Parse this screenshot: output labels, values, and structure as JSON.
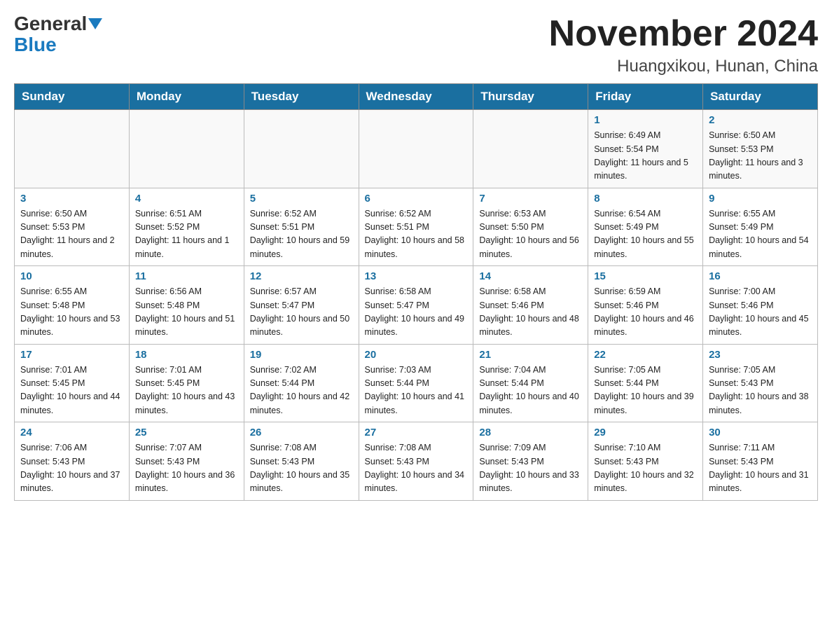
{
  "header": {
    "logo_general": "General",
    "logo_blue": "Blue",
    "month_title": "November 2024",
    "location": "Huangxikou, Hunan, China"
  },
  "days_of_week": [
    "Sunday",
    "Monday",
    "Tuesday",
    "Wednesday",
    "Thursday",
    "Friday",
    "Saturday"
  ],
  "weeks": [
    [
      {
        "day": "",
        "info": ""
      },
      {
        "day": "",
        "info": ""
      },
      {
        "day": "",
        "info": ""
      },
      {
        "day": "",
        "info": ""
      },
      {
        "day": "",
        "info": ""
      },
      {
        "day": "1",
        "info": "Sunrise: 6:49 AM\nSunset: 5:54 PM\nDaylight: 11 hours and 5 minutes."
      },
      {
        "day": "2",
        "info": "Sunrise: 6:50 AM\nSunset: 5:53 PM\nDaylight: 11 hours and 3 minutes."
      }
    ],
    [
      {
        "day": "3",
        "info": "Sunrise: 6:50 AM\nSunset: 5:53 PM\nDaylight: 11 hours and 2 minutes."
      },
      {
        "day": "4",
        "info": "Sunrise: 6:51 AM\nSunset: 5:52 PM\nDaylight: 11 hours and 1 minute."
      },
      {
        "day": "5",
        "info": "Sunrise: 6:52 AM\nSunset: 5:51 PM\nDaylight: 10 hours and 59 minutes."
      },
      {
        "day": "6",
        "info": "Sunrise: 6:52 AM\nSunset: 5:51 PM\nDaylight: 10 hours and 58 minutes."
      },
      {
        "day": "7",
        "info": "Sunrise: 6:53 AM\nSunset: 5:50 PM\nDaylight: 10 hours and 56 minutes."
      },
      {
        "day": "8",
        "info": "Sunrise: 6:54 AM\nSunset: 5:49 PM\nDaylight: 10 hours and 55 minutes."
      },
      {
        "day": "9",
        "info": "Sunrise: 6:55 AM\nSunset: 5:49 PM\nDaylight: 10 hours and 54 minutes."
      }
    ],
    [
      {
        "day": "10",
        "info": "Sunrise: 6:55 AM\nSunset: 5:48 PM\nDaylight: 10 hours and 53 minutes."
      },
      {
        "day": "11",
        "info": "Sunrise: 6:56 AM\nSunset: 5:48 PM\nDaylight: 10 hours and 51 minutes."
      },
      {
        "day": "12",
        "info": "Sunrise: 6:57 AM\nSunset: 5:47 PM\nDaylight: 10 hours and 50 minutes."
      },
      {
        "day": "13",
        "info": "Sunrise: 6:58 AM\nSunset: 5:47 PM\nDaylight: 10 hours and 49 minutes."
      },
      {
        "day": "14",
        "info": "Sunrise: 6:58 AM\nSunset: 5:46 PM\nDaylight: 10 hours and 48 minutes."
      },
      {
        "day": "15",
        "info": "Sunrise: 6:59 AM\nSunset: 5:46 PM\nDaylight: 10 hours and 46 minutes."
      },
      {
        "day": "16",
        "info": "Sunrise: 7:00 AM\nSunset: 5:46 PM\nDaylight: 10 hours and 45 minutes."
      }
    ],
    [
      {
        "day": "17",
        "info": "Sunrise: 7:01 AM\nSunset: 5:45 PM\nDaylight: 10 hours and 44 minutes."
      },
      {
        "day": "18",
        "info": "Sunrise: 7:01 AM\nSunset: 5:45 PM\nDaylight: 10 hours and 43 minutes."
      },
      {
        "day": "19",
        "info": "Sunrise: 7:02 AM\nSunset: 5:44 PM\nDaylight: 10 hours and 42 minutes."
      },
      {
        "day": "20",
        "info": "Sunrise: 7:03 AM\nSunset: 5:44 PM\nDaylight: 10 hours and 41 minutes."
      },
      {
        "day": "21",
        "info": "Sunrise: 7:04 AM\nSunset: 5:44 PM\nDaylight: 10 hours and 40 minutes."
      },
      {
        "day": "22",
        "info": "Sunrise: 7:05 AM\nSunset: 5:44 PM\nDaylight: 10 hours and 39 minutes."
      },
      {
        "day": "23",
        "info": "Sunrise: 7:05 AM\nSunset: 5:43 PM\nDaylight: 10 hours and 38 minutes."
      }
    ],
    [
      {
        "day": "24",
        "info": "Sunrise: 7:06 AM\nSunset: 5:43 PM\nDaylight: 10 hours and 37 minutes."
      },
      {
        "day": "25",
        "info": "Sunrise: 7:07 AM\nSunset: 5:43 PM\nDaylight: 10 hours and 36 minutes."
      },
      {
        "day": "26",
        "info": "Sunrise: 7:08 AM\nSunset: 5:43 PM\nDaylight: 10 hours and 35 minutes."
      },
      {
        "day": "27",
        "info": "Sunrise: 7:08 AM\nSunset: 5:43 PM\nDaylight: 10 hours and 34 minutes."
      },
      {
        "day": "28",
        "info": "Sunrise: 7:09 AM\nSunset: 5:43 PM\nDaylight: 10 hours and 33 minutes."
      },
      {
        "day": "29",
        "info": "Sunrise: 7:10 AM\nSunset: 5:43 PM\nDaylight: 10 hours and 32 minutes."
      },
      {
        "day": "30",
        "info": "Sunrise: 7:11 AM\nSunset: 5:43 PM\nDaylight: 10 hours and 31 minutes."
      }
    ]
  ]
}
